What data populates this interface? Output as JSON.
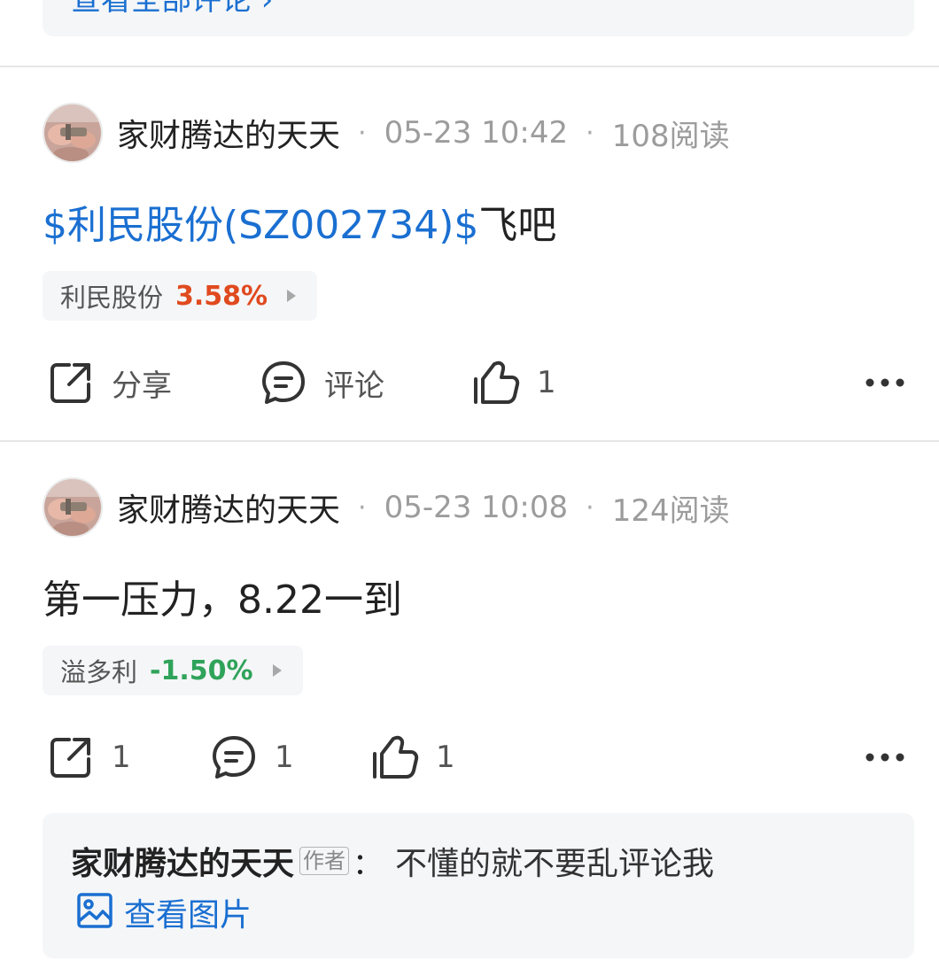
{
  "top_comment": {
    "link_label": "查看全部评论 ›"
  },
  "posts": [
    {
      "username": "家财腾达的天天",
      "time": "05-23 10:42",
      "reads": "108阅读",
      "body_link": "$利民股份(SZ002734)$",
      "body_text": "飞吧",
      "stock": {
        "name": "利民股份",
        "change": "3.58%",
        "direction": "up"
      },
      "actions": {
        "share": "分享",
        "comment": "评论",
        "like": "1"
      }
    },
    {
      "username": "家财腾达的天天",
      "time": "05-23 10:08",
      "reads": "124阅读",
      "body_link": "",
      "body_text": "第一压力，8.22一到",
      "stock": {
        "name": "溢多利",
        "change": "-1.50%",
        "direction": "down"
      },
      "actions": {
        "share": "1",
        "comment": "1",
        "like": "1"
      },
      "reply": {
        "author": "家财腾达的天天",
        "tag": "作者",
        "colon": "：",
        "text": "不懂的就不要乱评论我",
        "view_image": "查看图片"
      }
    }
  ],
  "meta_separator": "·",
  "colors": {
    "link": "#1a6fd1",
    "up": "#e04a1f",
    "down": "#2fa35a",
    "chip_bg": "#f5f6f8"
  },
  "icons": [
    "share-icon",
    "comment-icon",
    "like-icon",
    "more-icon",
    "image-icon"
  ]
}
